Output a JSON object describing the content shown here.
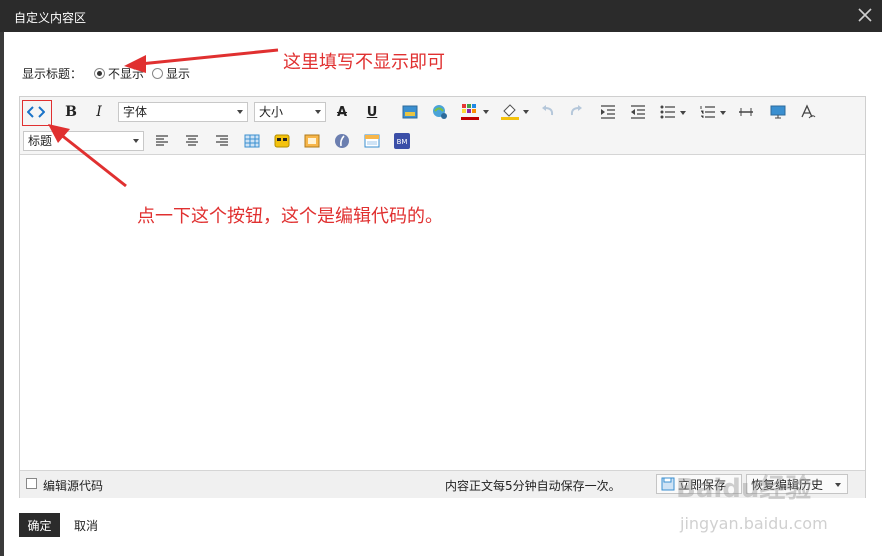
{
  "window": {
    "title": "自定义内容区"
  },
  "show_title": {
    "label": "显示标题：",
    "options": [
      {
        "label": "不显示",
        "selected": true
      },
      {
        "label": "显示",
        "selected": false
      }
    ]
  },
  "toolbar": {
    "font_select": "字体",
    "size_select": "大小",
    "heading_select": "标题",
    "bold": "B",
    "italic": "I",
    "strike": "A",
    "underline": "U"
  },
  "statusbar": {
    "source_code_label": "编辑源代码",
    "autosave_text": "内容正文每5分钟自动保存一次。",
    "save_now": "立即保存",
    "restore_history": "恢复编辑历史"
  },
  "footer": {
    "ok": "确定",
    "cancel": "取消"
  },
  "annotations": {
    "top": "这里填写不显示即可",
    "middle": "点一下这个按钮，这个是编辑代码的。"
  },
  "watermark": {
    "main": "Baidu经验",
    "sub": "jingyan.baidu.com"
  },
  "colors": {
    "titlebar": "#2b2b2b",
    "annotation": "#e03030",
    "accent": "#1a73c8"
  }
}
